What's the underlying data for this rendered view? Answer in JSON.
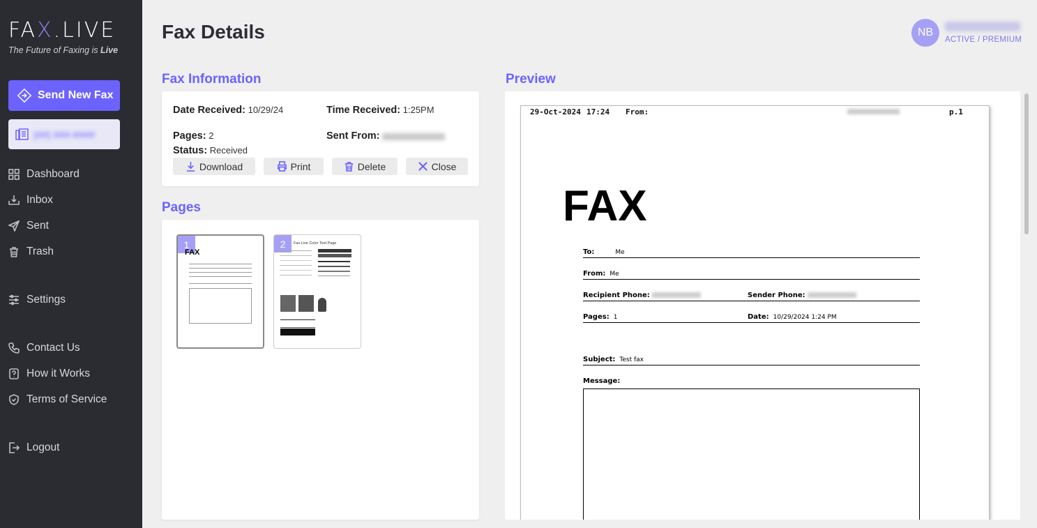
{
  "brand": {
    "logo_pre": "FA",
    "logo_x": "X",
    "logo_post": ".LIVE",
    "tagline_pre": "The Future of Faxing is ",
    "tagline_em": "Live",
    "accent": "#6c63ff"
  },
  "sidebar": {
    "send_label": "Send New Fax",
    "number_label": "(##) ###-####",
    "items": [
      {
        "label": "Dashboard",
        "icon": "grid-icon"
      },
      {
        "label": "Inbox",
        "icon": "inbox-icon"
      },
      {
        "label": "Sent",
        "icon": "send-icon"
      },
      {
        "label": "Trash",
        "icon": "trash-icon"
      },
      {
        "label": "Settings",
        "icon": "sliders-icon"
      },
      {
        "label": "Contact Us",
        "icon": "phone-icon"
      },
      {
        "label": "How it Works",
        "icon": "question-icon"
      },
      {
        "label": "Terms of Service",
        "icon": "shield-icon"
      },
      {
        "label": "Logout",
        "icon": "logout-icon"
      }
    ]
  },
  "header": {
    "title": "Fax Details",
    "avatar_initials": "NB",
    "user_status": "ACTIVE / PREMIUM"
  },
  "info": {
    "section_title": "Fax Information",
    "date_label": "Date Received:",
    "date_value": "10/29/24",
    "time_label": "Time Received:",
    "time_value": "1:25PM",
    "pages_label": "Pages:",
    "pages_value": "2",
    "sent_from_label": "Sent From:",
    "status_label": "Status:",
    "status_value": "Received",
    "buttons": {
      "download": "Download",
      "print": "Print",
      "delete": "Delete",
      "close": "Close"
    }
  },
  "pages": {
    "section_title": "Pages",
    "thumbs": [
      {
        "num": "1",
        "title": "FAX"
      },
      {
        "num": "2",
        "title": "Fax.Live Color Test Page"
      }
    ]
  },
  "preview": {
    "section_title": "Preview",
    "hdr_date": "29-Oct-2024",
    "hdr_time": "17:24",
    "hdr_from": "From:",
    "hdr_page": "p.1",
    "big": "FAX",
    "to_label": "To:",
    "to_value": "Me",
    "from_label": "From:",
    "from_value": "Me",
    "rphone_label": "Recipient Phone:",
    "sphone_label": "Sender Phone:",
    "pages_label": "Pages:",
    "pages_value": "1",
    "date_label": "Date:",
    "date_value": "10/29/2024 1:24 PM",
    "subject_label": "Subject:",
    "subject_value": "Test fax",
    "message_label": "Message:"
  }
}
